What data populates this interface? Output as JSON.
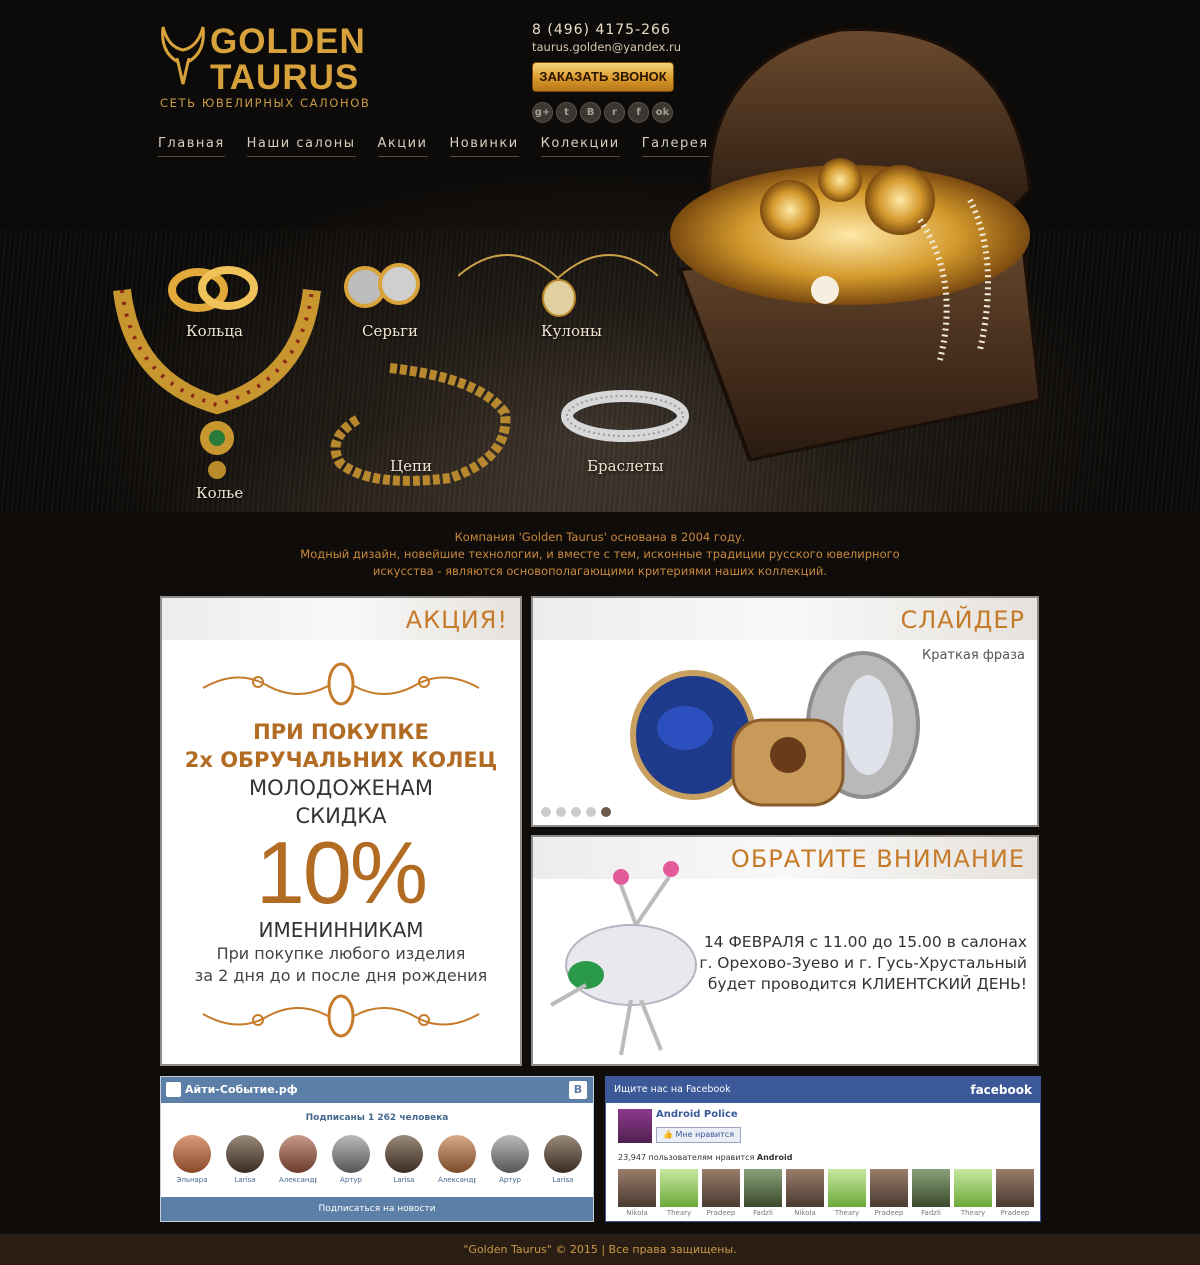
{
  "brand": {
    "name_line1": "GOLDEN",
    "name_line2": "TAURUS",
    "tagline": "СЕТЬ ЮВЕЛИРНЫХ САЛОНОВ"
  },
  "contact": {
    "phone": "8 (496) 4175-266",
    "email": "taurus.golden@yandex.ru",
    "call_button": "ЗАКАЗАТЬ ЗВОНОК"
  },
  "social_icons": [
    {
      "icon": "google-plus-icon",
      "glyph": "g+"
    },
    {
      "icon": "twitter-icon",
      "glyph": "t"
    },
    {
      "icon": "vk-icon",
      "glyph": "B"
    },
    {
      "icon": "rss-icon",
      "glyph": "r"
    },
    {
      "icon": "facebook-icon",
      "glyph": "f"
    },
    {
      "icon": "odnoklassniki-icon",
      "glyph": "ok"
    }
  ],
  "nav": [
    "Главная",
    "Наши салоны",
    "Акции",
    "Новинки",
    "Колекции",
    "Галерея"
  ],
  "categories": {
    "rings": "Кольца",
    "earrings": "Серьги",
    "pendants": "Кулоны",
    "necklace": "Колье",
    "chains": "Цепи",
    "bracelets": "Браслеты"
  },
  "intro": {
    "line1": "Компания 'Golden Taurus' основана в 2004 году.",
    "line2": "Модный дизайн, новейшие технологии, и вместе с тем, исконные традиции русского ювелирного",
    "line3": "искусства - являются основополагающими критериями наших коллекций."
  },
  "promo": {
    "title": "АКЦИЯ!",
    "line1": "ПРИ ПОКУПКЕ",
    "line2": "2х ОБРУЧАЛЬНИХ КОЛЕЦ",
    "line3": "МОЛОДОЖЕНАМ",
    "line4": "СКИДКА",
    "discount": "10%",
    "line5": "ИМЕНИННИКАМ",
    "line6": "При покупке любого изделия",
    "line7": "за 2 дня до и после дня рождения"
  },
  "slider": {
    "title": "СЛАЙДЕР",
    "subtitle": "Краткая фраза",
    "slide_count": 5,
    "active_slide": 5
  },
  "notice": {
    "title": "ОБРАТИТЕ ВНИМАНИЕ",
    "line1": "14 ФЕВРАЛЯ с 11.00 до 15.00 в салонах",
    "line2": "г. Орехово-Зуево и г. Гусь-Хрустальный",
    "line3": "будет проводится КЛИЕНТСКИЙ ДЕНЬ!"
  },
  "vk_widget": {
    "title": "Айти-Событие.рф",
    "subscribers": "Подписаны 1 262 человека",
    "members": [
      "Эльнара",
      "Larisa",
      "Александра",
      "Артур",
      "Larisa",
      "Александра",
      "Артур",
      "Larisa"
    ],
    "subscribe_button": "Подписаться на новости"
  },
  "fb_widget": {
    "header": "Ищите нас на Facebook",
    "brand": "facebook",
    "page_name": "Android Police",
    "like_button": "Мне нравится",
    "like_count_prefix": "23,947 пользователям нравится ",
    "like_count_page": "Android",
    "fans": [
      "Nikola",
      "Theary",
      "Pradeep",
      "Fadzli",
      "Nikola",
      "Theary",
      "Pradeep",
      "Fadzli",
      "Theary",
      "Pradeep"
    ]
  },
  "footer": "\"Golden Taurus\"  © 2015  |  Все права защищены."
}
